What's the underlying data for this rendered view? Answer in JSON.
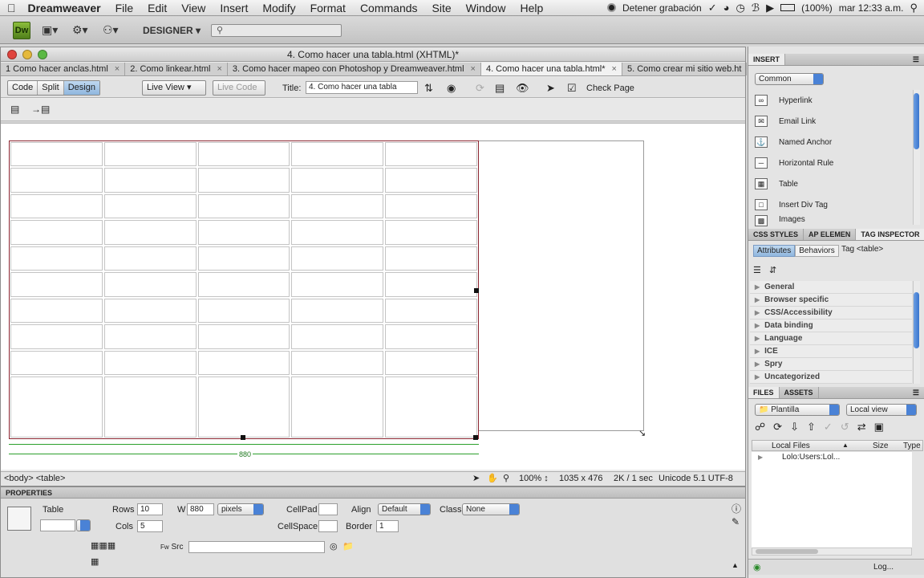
{
  "menubar": {
    "apple": "",
    "app": "Dreamweaver",
    "items": [
      "File",
      "Edit",
      "View",
      "Insert",
      "Modify",
      "Format",
      "Commands",
      "Site",
      "Window",
      "Help"
    ],
    "recording": "Detener grabación",
    "battery": "(100%)",
    "clock": "mar 12:33 a.m."
  },
  "app_toolbar": {
    "logo": "Dw",
    "workspace": "DESIGNER",
    "search_placeholder": ""
  },
  "document": {
    "title": "4. Como hacer una tabla.html (XHTML)*",
    "tabs": [
      {
        "label": "1 Como hacer anclas.html"
      },
      {
        "label": "2. Como linkear.html"
      },
      {
        "label": "3. Como hacer mapeo con Photoshop y Dreamweaver.html"
      },
      {
        "label": "4. Como hacer una tabla.html*"
      },
      {
        "label": "5. Como crear mi sitio web.ht"
      }
    ],
    "views": {
      "code": "Code",
      "split": "Split",
      "design": "Design"
    },
    "live_view": "Live View",
    "live_code": "Live Code",
    "title_label": "Title:",
    "title_value": "4. Como hacer una tabla",
    "check_page": "Check Page",
    "table_width_label": "880",
    "status": {
      "tags": "<body> <table>",
      "zoom": "100%",
      "dimensions": "1035 x 476",
      "download": "2K / 1 sec",
      "encoding": "Unicode 5.1 UTF-8"
    }
  },
  "properties": {
    "header": "PROPERTIES",
    "table_label": "Table",
    "rows_label": "Rows",
    "rows_value": "10",
    "cols_label": "Cols",
    "cols_value": "5",
    "w_label": "W",
    "w_value": "880",
    "w_unit": "pixels",
    "cellpad_label": "CellPad",
    "cellspace_label": "CellSpace",
    "align_label": "Align",
    "align_value": "Default",
    "border_label": "Border",
    "border_value": "1",
    "class_label": "Class",
    "class_value": "None",
    "src_label": "Src"
  },
  "insert_panel": {
    "header": "INSERT",
    "category": "Common",
    "items": [
      {
        "label": "Hyperlink",
        "icon": "hyperlink-icon"
      },
      {
        "label": "Email Link",
        "icon": "email-icon"
      },
      {
        "label": "Named Anchor",
        "icon": "anchor-icon"
      },
      {
        "label": "Horizontal Rule",
        "icon": "rule-icon"
      },
      {
        "label": "Table",
        "icon": "table-icon"
      },
      {
        "label": "Insert Div Tag",
        "icon": "div-icon"
      },
      {
        "label": "Images",
        "icon": "image-icon"
      }
    ]
  },
  "tag_panel": {
    "tabs": [
      "CSS STYLES",
      "AP ELEMEN",
      "TAG INSPECTOR"
    ],
    "attributes": "Attributes",
    "behaviors": "Behaviors",
    "tag": "Tag <table>",
    "categories": [
      "General",
      "Browser specific",
      "CSS/Accessibility",
      "Data binding",
      "Language",
      "ICE",
      "Spry",
      "Uncategorized"
    ]
  },
  "files_panel": {
    "tabs": [
      "FILES",
      "ASSETS"
    ],
    "site": "Plantilla",
    "view": "Local view",
    "col_local": "Local Files",
    "col_size": "Size",
    "col_type": "Type",
    "root": "Lolo:Users:Lol...",
    "log": "Log..."
  }
}
